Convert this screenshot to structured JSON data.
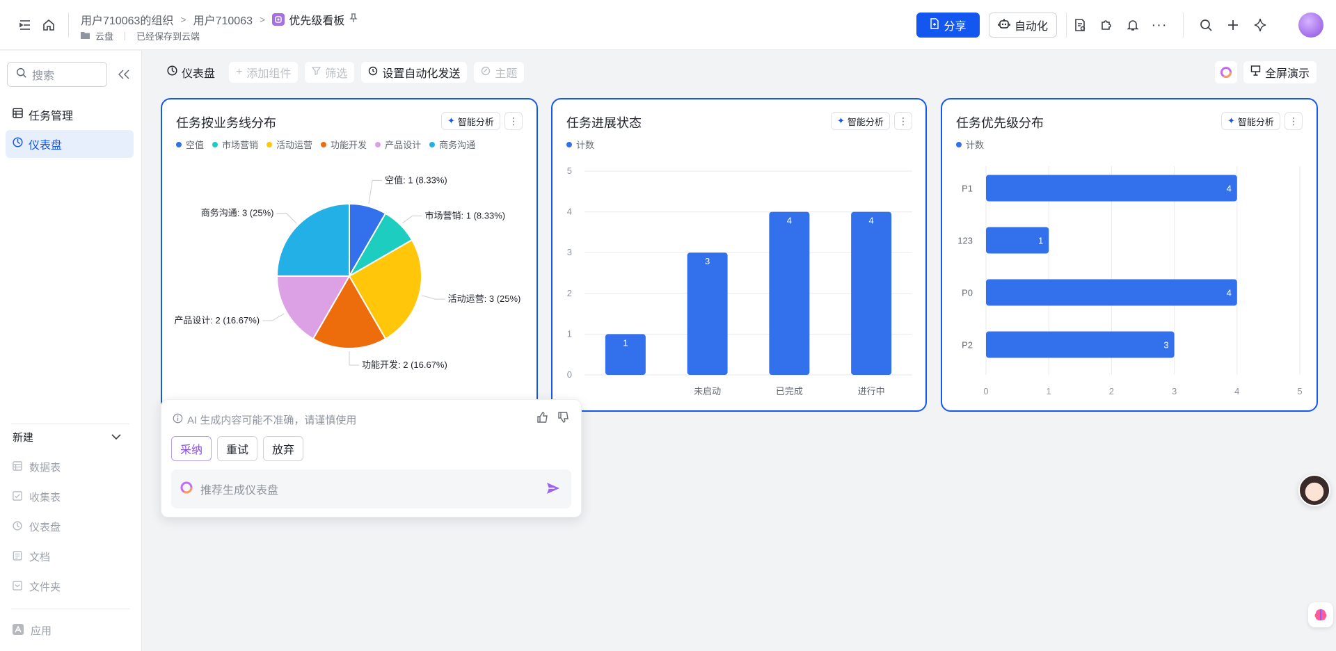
{
  "topbar": {
    "breadcrumbs": [
      "用户710063的组织",
      "用户710063",
      "优先级看板"
    ],
    "cloud_label": "云盘",
    "save_status": "已经保存到云端",
    "share_label": "分享",
    "automation_label": "自动化"
  },
  "sidebar": {
    "search_placeholder": "搜索",
    "items": [
      {
        "label": "任务管理"
      },
      {
        "label": "仪表盘"
      }
    ],
    "new_label": "新建",
    "new_items": [
      {
        "label": "数据表"
      },
      {
        "label": "收集表"
      },
      {
        "label": "仪表盘"
      },
      {
        "label": "文档"
      },
      {
        "label": "文件夹"
      }
    ],
    "apps_label": "应用"
  },
  "toolbar": {
    "dashboard_label": "仪表盘",
    "add_widget": "添加组件",
    "filter": "筛选",
    "auto_send": "设置自动化发送",
    "theme": "主题",
    "fullscreen": "全屏演示"
  },
  "cards": {
    "ai_label": "智能分析",
    "pie_title": "任务按业务线分布",
    "bar_title": "任务进展状态",
    "hbar_title": "任务优先级分布"
  },
  "colors": {
    "primary": "#1456f0",
    "bar": "#3370eb",
    "pie": [
      "#3370eb",
      "#1ccdc0",
      "#ffc60a",
      "#ed6d0c",
      "#dca1e4",
      "#23b0e6"
    ]
  },
  "chart_data": [
    {
      "type": "pie",
      "title": "任务按业务线分布",
      "labels": [
        "空值",
        "市场营销",
        "活动运营",
        "功能开发",
        "产品设计",
        "商务沟通"
      ],
      "values": [
        1,
        1,
        3,
        2,
        2,
        3
      ],
      "slice_labels": [
        "空值: 1 (8.33%)",
        "市场营销: 1 (8.33%)",
        "活动运营: 3 (25%)",
        "功能开发: 2 (16.67%)",
        "产品设计: 2 (16.67%)",
        "商务沟通: 3 (25%)"
      ],
      "legend": "top-left"
    },
    {
      "type": "bar",
      "title": "任务进展状态",
      "categories": [
        "",
        "未启动",
        "已完成",
        "进行中"
      ],
      "series": [
        {
          "name": "计数",
          "values": [
            1,
            3,
            4,
            4
          ]
        }
      ],
      "ylim": [
        0,
        5
      ],
      "yticks": [
        0,
        1,
        2,
        3,
        4,
        5
      ],
      "grid": true,
      "legend": "top-left"
    },
    {
      "type": "bar",
      "orientation": "horizontal",
      "title": "任务优先级分布",
      "categories": [
        "P1",
        "123",
        "P0",
        "P2"
      ],
      "series": [
        {
          "name": "计数",
          "values": [
            4,
            1,
            4,
            3
          ]
        }
      ],
      "xlim": [
        0,
        5
      ],
      "xticks": [
        0,
        1,
        2,
        3,
        4,
        5
      ],
      "grid": true,
      "legend": "top-left"
    }
  ],
  "popover": {
    "warning": "AI 生成内容可能不准确，请谨慎使用",
    "adopt": "采纳",
    "retry": "重试",
    "discard": "放弃",
    "input_placeholder": "推荐生成仪表盘"
  }
}
